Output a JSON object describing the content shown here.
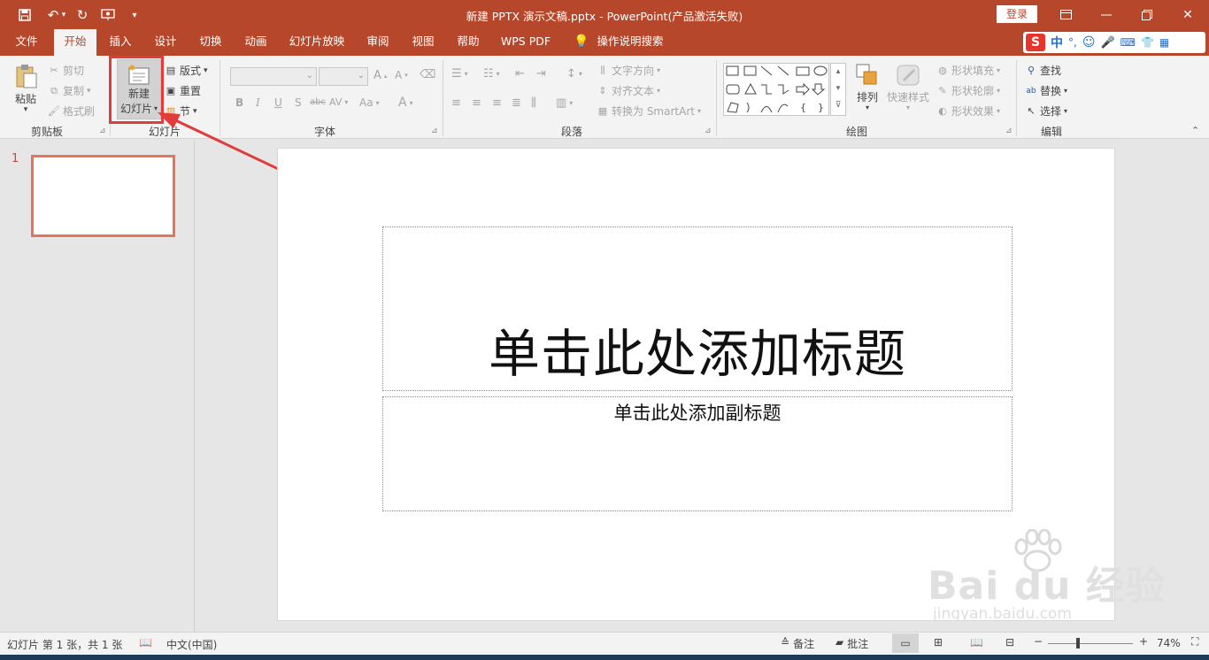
{
  "window": {
    "title": "新建 PPTX 演示文稿.pptx  -  PowerPoint(产品激活失败)",
    "login_label": "登录"
  },
  "qat_icons": [
    "save-icon",
    "undo-icon",
    "redo-icon",
    "present-from-start-icon",
    "customize-qat-icon"
  ],
  "tabs": [
    {
      "label": "文件"
    },
    {
      "label": "开始"
    },
    {
      "label": "插入"
    },
    {
      "label": "设计"
    },
    {
      "label": "切换"
    },
    {
      "label": "动画"
    },
    {
      "label": "幻灯片放映"
    },
    {
      "label": "审阅"
    },
    {
      "label": "视图"
    },
    {
      "label": "帮助"
    },
    {
      "label": "WPS PDF"
    },
    {
      "label": "操作说明搜索"
    }
  ],
  "ime": {
    "lang": "中"
  },
  "ribbon": {
    "clipboard": {
      "label": "剪贴板",
      "paste": "粘贴",
      "cut": "剪切",
      "copy": "复制",
      "format_painter": "格式刷"
    },
    "slides": {
      "label": "幻灯片",
      "new_slide_1": "新建",
      "new_slide_2": "幻灯片",
      "layout": "版式",
      "reset": "重置",
      "section": "节"
    },
    "font": {
      "label": "字体",
      "bold": "B",
      "italic": "I",
      "underline": "U",
      "shadow": "S",
      "strike": "abc",
      "spacing": "AV",
      "case": "Aa",
      "color": "A"
    },
    "paragraph": {
      "label": "段落",
      "text_direction": "文字方向",
      "align_text": "对齐文本",
      "smartart": "转换为 SmartArt"
    },
    "drawing": {
      "label": "绘图",
      "arrange": "排列",
      "quick_styles": "快速样式",
      "shape_fill": "形状填充",
      "shape_outline": "形状轮廓",
      "shape_effects": "形状效果"
    },
    "editing": {
      "label": "编辑",
      "find": "查找",
      "replace": "替换",
      "select": "选择"
    }
  },
  "thumbnails": [
    {
      "number": "1"
    }
  ],
  "slide": {
    "title_placeholder": "单击此处添加标题",
    "subtitle_placeholder": "单击此处添加副标题"
  },
  "status": {
    "slide_info": "幻灯片 第 1 张，共 1 张",
    "language": "中文(中国)",
    "notes": "备注",
    "comments": "批注",
    "zoom": "74%"
  },
  "watermark": {
    "brand": "Bai du 经验",
    "url": "jingyan.baidu.com"
  },
  "colors": {
    "accent": "#b7472a",
    "highlight_red": "#e23b3b",
    "thumb_border": "#e8735a"
  }
}
